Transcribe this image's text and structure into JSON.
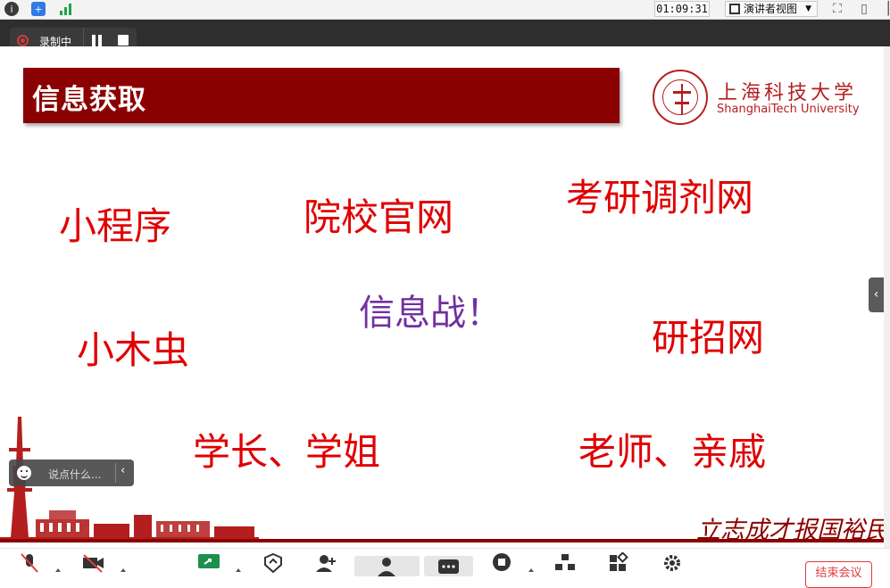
{
  "topbar": {
    "timer": "01:09:31",
    "view_mode_label": "演讲者视图"
  },
  "recording": {
    "status_label": "录制中"
  },
  "slide": {
    "title": "信息获取",
    "university_cn": "上海科技大学",
    "university_en": "ShanghaiTech University",
    "words": {
      "mini_program": "小程序",
      "school_site": "院校官网",
      "transfer_site": "考研调剂网",
      "info_war": "信息战！",
      "xiaomuchong": "小木虫",
      "yanzhao": "研招网",
      "seniors": "学长、学姐",
      "teachers": "老师、亲戚"
    },
    "motto": "立志成才报国裕民"
  },
  "chat": {
    "placeholder": "说点什么..."
  },
  "toolbar": {
    "end_meeting_label": "结束会议"
  },
  "colors": {
    "title_bg": "#8b0000",
    "word_red": "#e00000",
    "word_purple": "#7030a0",
    "brand_red": "#b41e1e",
    "end_button": "#e03c3c"
  }
}
